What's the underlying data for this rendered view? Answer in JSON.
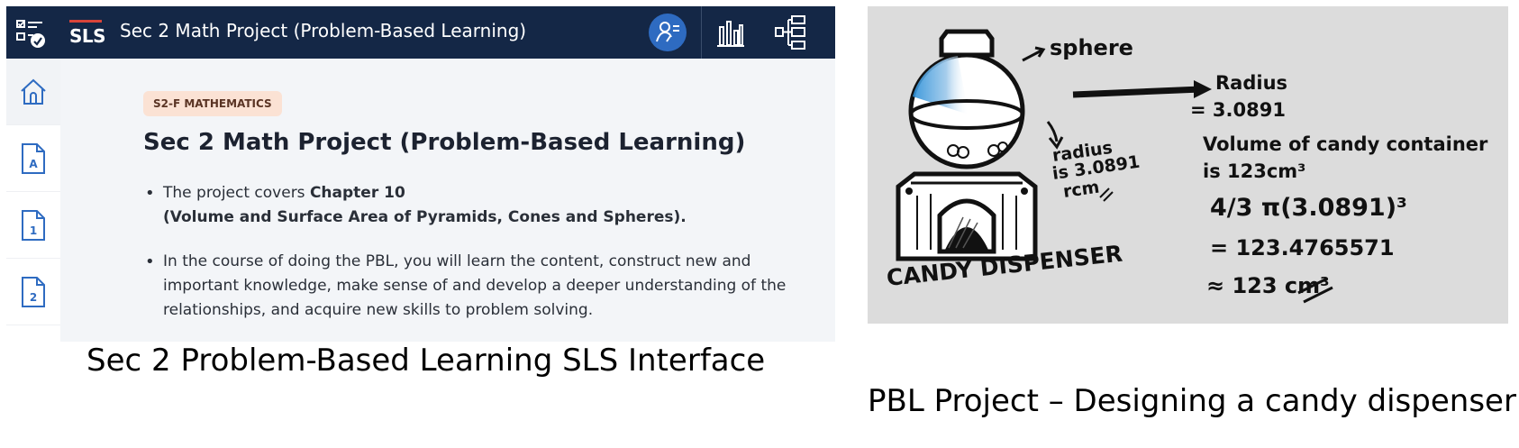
{
  "sls": {
    "app_logo": "SLS",
    "title": "Sec 2 Math Project (Problem-Based Learning)",
    "icons": {
      "tasks": "tasks-icon",
      "avatar": "user-settings-icon",
      "chart": "bar-chart-icon",
      "tree": "tree-structure-icon"
    },
    "sidebar": [
      {
        "name": "home",
        "label": ""
      },
      {
        "name": "page-a",
        "label": "A"
      },
      {
        "name": "page-1",
        "label": "1"
      },
      {
        "name": "page-2",
        "label": "2"
      }
    ],
    "content": {
      "chip": "S2-F MATHEMATICS",
      "heading": "Sec 2 Math Project (Problem-Based Learning)",
      "bullet1_prefix": "The project covers ",
      "bullet1_bold": "Chapter 10",
      "bullet1_line2": "(Volume and Surface Area of Pyramids, Cones and Spheres).",
      "bullet2": "In the course of doing the PBL, you will learn the content, construct new and important knowledge, make sense of and develop a deeper understanding of the relationships, and acquire new skills to problem solving."
    },
    "colors": {
      "topbar": "#142746",
      "accent": "#2e6bc1",
      "chip_bg": "#fbe2d4",
      "logo_bar": "#d9443a"
    }
  },
  "caption_left": "Sec 2 Problem-Based Learning SLS Interface",
  "drawing": {
    "sphere_label": "sphere",
    "radius_label": "Radius",
    "radius_value": "= 3.0891",
    "radius_note_1": "radius",
    "radius_note_2": "is 3.0891",
    "radius_note_3": "rcm",
    "volume_line_1": "Volume of candy container",
    "volume_line_2": "is 123cm³",
    "formula": "4/3 π(3.0891)³",
    "result": "= 123.4765571",
    "approx": "≈ 123 cm³",
    "dispenser_label": "CANDY DISPENSER"
  },
  "caption_right": "PBL Project – Designing a candy dispenser"
}
